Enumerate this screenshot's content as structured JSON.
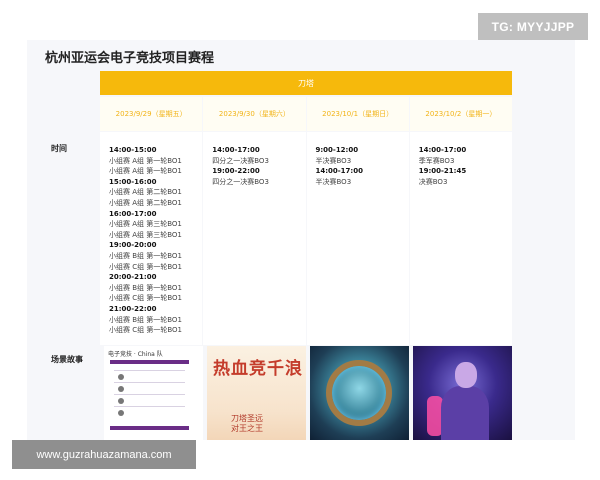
{
  "page": {
    "title": "杭州亚运会电子竞技项目赛程",
    "tg_badge": "TG: MYYJJPP",
    "url_badge": "www.guzrahuazamana.com"
  },
  "event": {
    "name": "刀塔"
  },
  "dates": [
    "2023/9/29（星期五）",
    "2023/9/30（星期六）",
    "2023/10/1（星期日）",
    "2023/10/2（星期一）"
  ],
  "labels": {
    "time": "时间",
    "scene": "场景故事"
  },
  "schedule": [
    [
      {
        "time": "14:00-15:00",
        "items": [
          "小组赛 A组 第一轮BO1",
          "小组赛 A组 第一轮BO1"
        ]
      },
      {
        "time": "15:00-16:00",
        "items": [
          "小组赛 A组 第二轮BO1",
          "小组赛 A组 第二轮BO1"
        ]
      },
      {
        "time": "16:00-17:00",
        "items": [
          "小组赛 A组 第三轮BO1",
          "小组赛 A组 第三轮BO1"
        ]
      },
      {
        "time": "19:00-20:00",
        "items": [
          "小组赛 B组 第一轮BO1",
          "小组赛 C组 第一轮BO1"
        ]
      },
      {
        "time": "20:00-21:00",
        "items": [
          "小组赛 B组 第一轮BO1",
          "小组赛 C组 第一轮BO1"
        ]
      },
      {
        "time": "21:00-22:00",
        "items": [
          "小组赛 B组 第一轮BO1",
          "小组赛 C组 第一轮BO1"
        ]
      }
    ],
    [
      {
        "time": "14:00-17:00",
        "items": [
          "四分之一决赛BO3"
        ]
      },
      {
        "time": "19:00-22:00",
        "items": [
          "四分之一决赛BO3"
        ]
      }
    ],
    [
      {
        "time": "9:00-12:00",
        "items": [
          "半决赛BO3"
        ]
      },
      {
        "time": "14:00-17:00",
        "items": [
          "半决赛BO3"
        ]
      }
    ],
    [
      {
        "time": "14:00-17:00",
        "items": [
          "季军赛BO3"
        ]
      },
      {
        "time": "19:00-21:45",
        "items": [
          "决赛BO3"
        ]
      }
    ]
  ],
  "scene_images": [
    {
      "name": "china-team-roster",
      "caption": "电子竞技 · China 队"
    },
    {
      "name": "dota-poster",
      "text": "热血竞千浪",
      "subtext": "刀塔圣远\n对王之王"
    },
    {
      "name": "aegis-shield"
    },
    {
      "name": "hero-artwork"
    }
  ]
}
